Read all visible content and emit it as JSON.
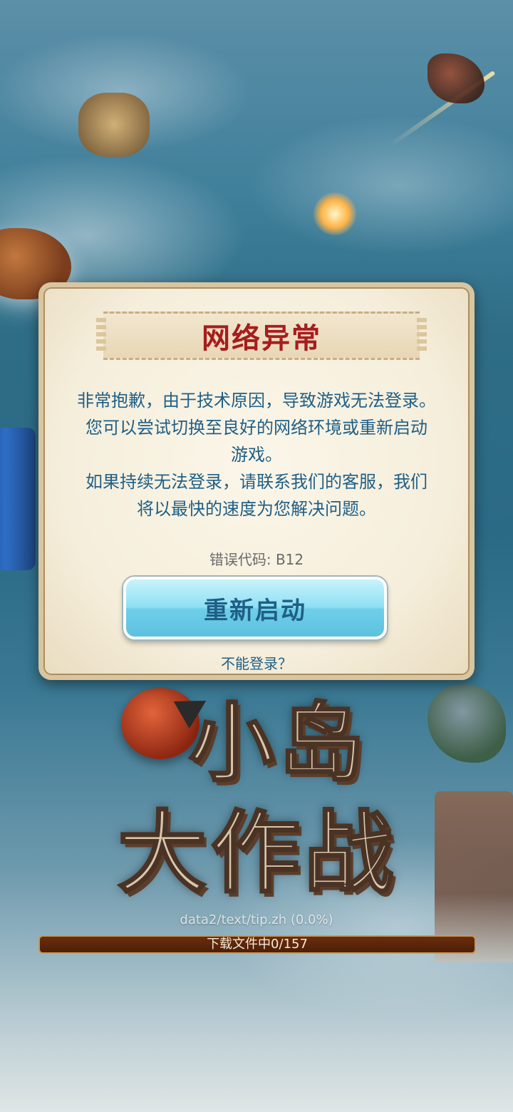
{
  "dialog": {
    "title": "网络异常",
    "message_lines": [
      "非常抱歉，由于技术原因，导致游戏无法登录。",
      "您可以尝试切换至良好的网络环境或重新启动",
      "游戏。",
      "如果持续无法登录，请联系我们的客服，我们",
      "将以最快的速度为您解决问题。"
    ],
    "error_code": "错误代码: B12",
    "restart_button": "重新启动",
    "cant_login_link": "不能登录？"
  },
  "logo": {
    "line1": "小岛",
    "line2": "大作战"
  },
  "loading": {
    "file_status": "data2/text/tip.zh (0.0%)",
    "progress_text": "下载文件中0/157",
    "progress_fraction": 0.0
  },
  "colors": {
    "title_red": "#a61d1d",
    "message_blue": "#1f5f86",
    "button_cyan": "#8fe0f3",
    "progress_brown": "#6a2d0d"
  }
}
